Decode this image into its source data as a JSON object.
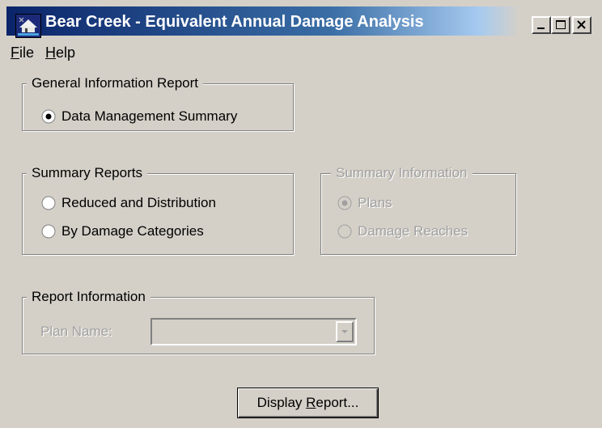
{
  "window": {
    "title": "Bear Creek - Equivalent Annual Damage Analysis",
    "icon": "app-icon"
  },
  "menu": {
    "file": {
      "label": "File",
      "mnemonic": "F"
    },
    "help": {
      "label": "Help",
      "mnemonic": "H"
    }
  },
  "general_info": {
    "legend": "General Information Report",
    "options": [
      {
        "label": "Data Management Summary",
        "selected": true
      }
    ]
  },
  "summary_reports": {
    "legend": "Summary Reports",
    "options": [
      {
        "label": "Reduced and Distribution",
        "selected": false
      },
      {
        "label": "By Damage Categories",
        "selected": false
      }
    ]
  },
  "summary_info": {
    "legend": "Summary Information",
    "enabled": false,
    "options": [
      {
        "label": "Plans",
        "selected": true
      },
      {
        "label": "Damage Reaches",
        "selected": false
      }
    ]
  },
  "report_info": {
    "legend": "Report Information",
    "plan_name_label": "Plan Name:",
    "plan_name_value": "",
    "enabled": false
  },
  "display_button": {
    "label": "Display Report...",
    "mnemonic": "R"
  }
}
